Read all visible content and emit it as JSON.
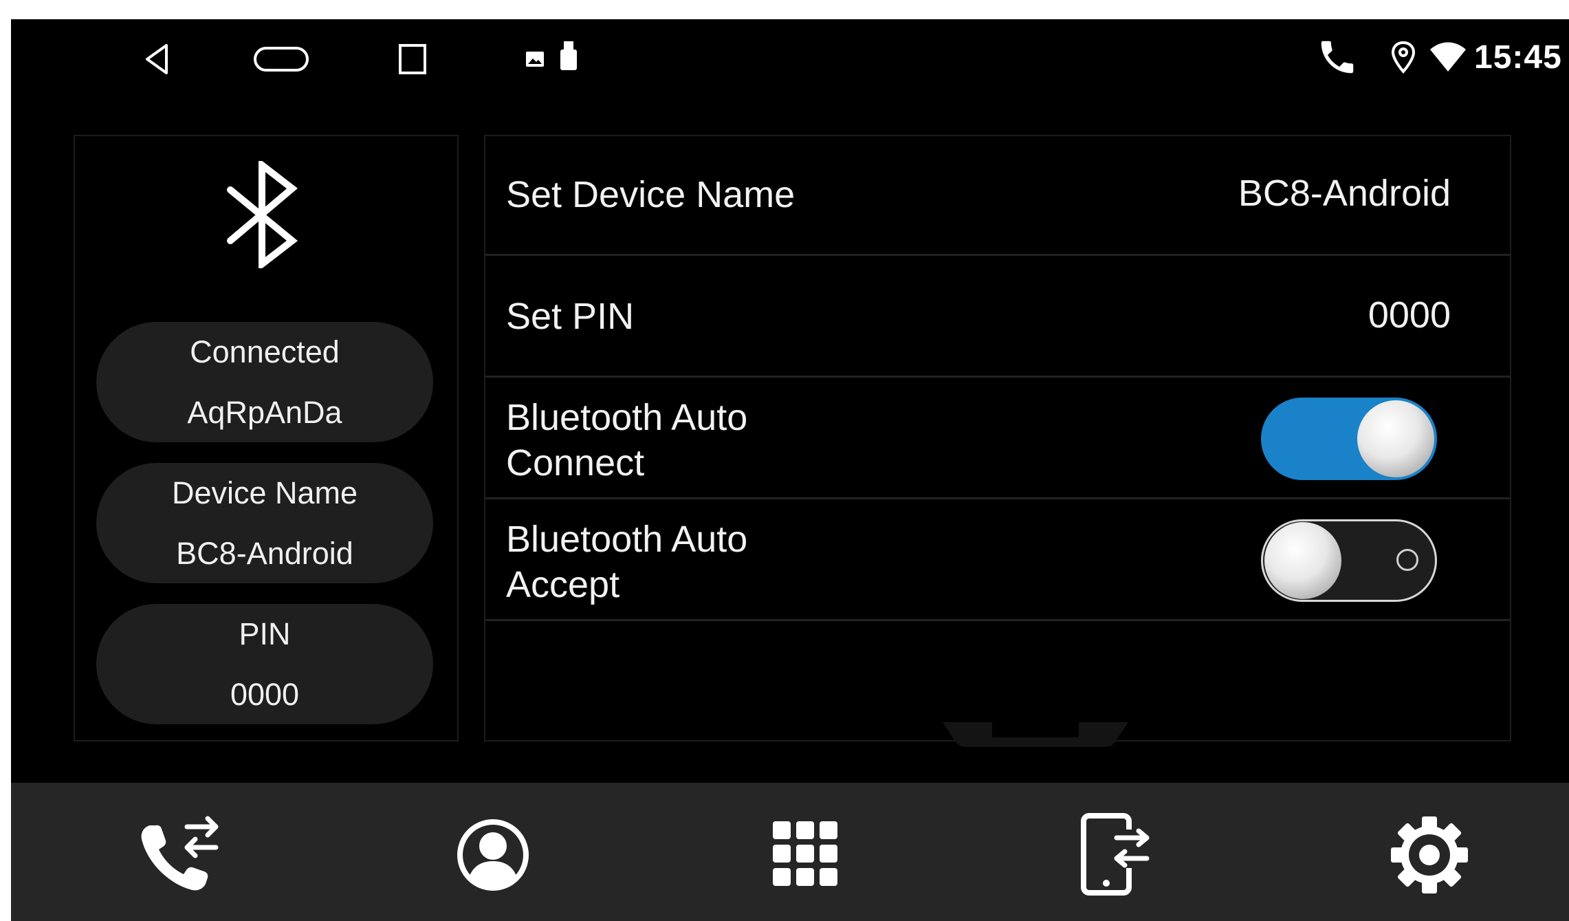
{
  "status_bar": {
    "time": "15:45",
    "nav_icons": [
      "back-icon",
      "home-icon",
      "recents-icon"
    ],
    "notification_icons": [
      "image-icon",
      "usb-drive-icon"
    ],
    "status_icons": [
      "phone-icon",
      "location-icon",
      "wifi-icon"
    ]
  },
  "info_panel": {
    "icon": "bluetooth-icon",
    "connected_label": "Connected",
    "connected_value": "AqRpAnDa",
    "device_name_label": "Device Name",
    "device_name_value": "BC8-Android",
    "pin_label": "PIN",
    "pin_value": "0000"
  },
  "settings": {
    "device_name": {
      "label": "Set Device Name",
      "value": "BC8-Android"
    },
    "pin": {
      "label": "Set PIN",
      "value": "0000"
    },
    "auto_connect": {
      "label_line1": "Bluetooth Auto",
      "label_line2": "Connect",
      "enabled": true
    },
    "auto_accept": {
      "label_line1": "Bluetooth Auto",
      "label_line2": "Accept",
      "enabled": false
    }
  },
  "bottom_nav": {
    "items": [
      "call-transfer-icon",
      "contacts-icon",
      "dialpad-icon",
      "device-transfer-icon",
      "settings-icon"
    ]
  },
  "colors": {
    "accent": "#1a82c8",
    "background": "#000000",
    "panel": "#1f1f1f",
    "bottom_bar": "#262626"
  }
}
